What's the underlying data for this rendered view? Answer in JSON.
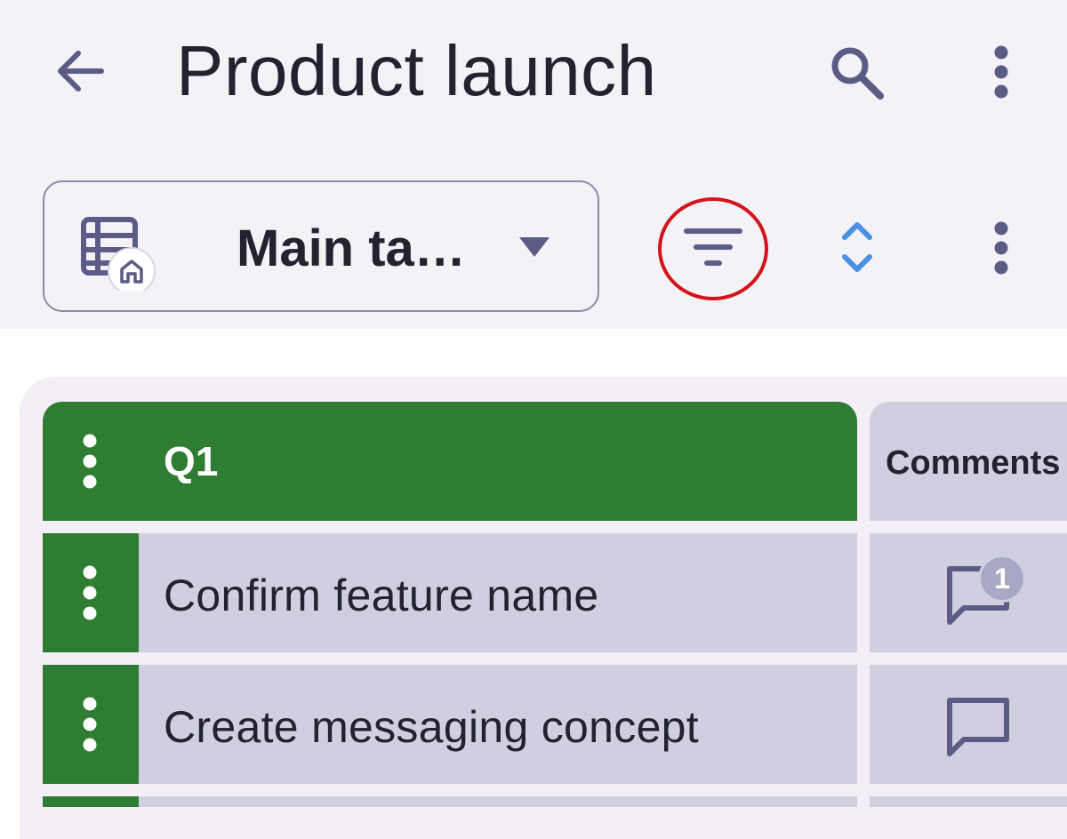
{
  "app_bar": {
    "title": "Product launch",
    "back_icon": "arrow-left-icon",
    "search_icon": "search-icon",
    "more_icon": "more-vertical-icon"
  },
  "toolbar": {
    "view_name": "Main ta…",
    "view_icon": "table-home-icon",
    "filter_icon": "filter-icon",
    "sort_icon": "sort-icon",
    "more_icon": "more-vertical-icon"
  },
  "table": {
    "group": {
      "title": "Q1",
      "color": "#2e7d32"
    },
    "columns": [
      {
        "label": "Comments"
      }
    ],
    "rows": [
      {
        "name": "Confirm feature name",
        "comment_count": "1"
      },
      {
        "name": "Create messaging concept",
        "comment_count": ""
      }
    ]
  },
  "colors": {
    "background": "#f3f2f7",
    "accent": "#5a5c86",
    "sort_accent": "#4a90e2",
    "highlight": "#d4141a",
    "cell": "#d0cfe0",
    "group": "#2e7d32"
  }
}
